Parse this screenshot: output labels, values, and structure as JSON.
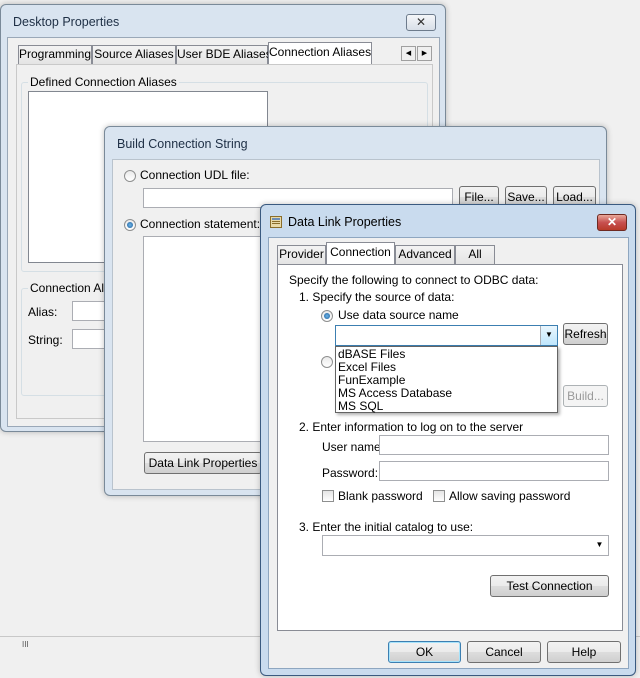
{
  "desktop_properties": {
    "title": "Desktop Properties",
    "close_glyph": "✕",
    "tabs": [
      "Programming",
      "Source Aliases",
      "User BDE Aliases",
      "Connection Aliases"
    ],
    "scroll_left": "◀",
    "scroll_right": "▶",
    "defined_group_label": "Defined Connection Aliases",
    "connection_alias_group_label": "Connection Alia",
    "alias_label": "Alias:",
    "string_label": "String:"
  },
  "build_connection": {
    "title": "Build Connection String",
    "udl_label": "Connection UDL file:",
    "udl_value": "",
    "file_button": "File...",
    "save_button": "Save...",
    "load_button": "Load...",
    "statement_label": "Connection statement:",
    "data_link_button": "Data Link Properties",
    "selected_option": "Connection statement"
  },
  "data_link": {
    "title": "Data Link Properties",
    "close_glyph": "✕",
    "tabs": [
      "Provider",
      "Connection",
      "Advanced",
      "All"
    ],
    "selected_tab": "Connection",
    "intro": "Specify the following to connect to ODBC data:",
    "step1": "1. Specify the source of data:",
    "use_dsn_label": "Use data source name",
    "dsn_value": "",
    "dsn_options": [
      "dBASE Files",
      "Excel Files",
      "FunExample",
      "MS Access Database",
      "MS SQL"
    ],
    "refresh_button": "Refresh",
    "build_button": "Build...",
    "step2": "2. Enter information to log on to the server",
    "user_name_label": "User name:",
    "user_name_value": "",
    "password_label": "Password:",
    "password_value": "",
    "blank_password_label": "Blank password",
    "allow_saving_label": "Allow saving password",
    "step3": "3. Enter the initial catalog to use:",
    "catalog_value": "",
    "test_button": "Test Connection",
    "ok_button": "OK",
    "cancel_button": "Cancel",
    "help_button": "Help"
  },
  "background": {
    "scroll_grip": "III"
  }
}
